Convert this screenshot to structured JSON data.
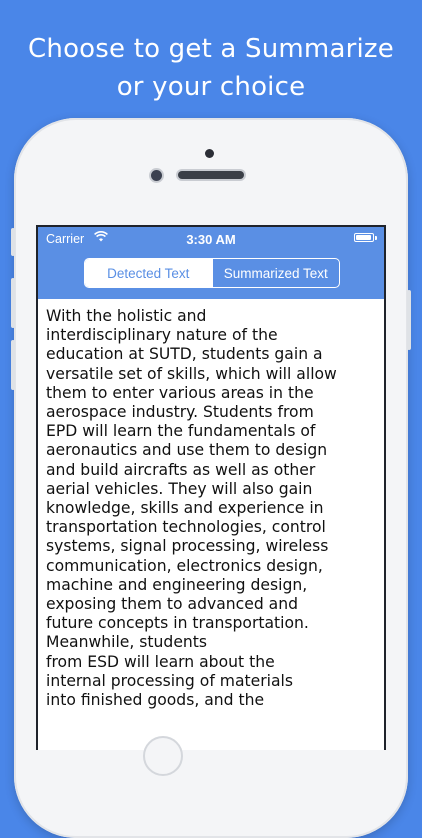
{
  "headline": {
    "line1": "Choose to get a Summarize",
    "line2": "or your choice"
  },
  "status_bar": {
    "carrier": "Carrier",
    "time": "3:30 AM",
    "battery_level": 1.0
  },
  "segmented_control": {
    "tabs": [
      {
        "label": "Detected Text",
        "selected": true
      },
      {
        "label": "Summarized Text",
        "selected": false
      }
    ]
  },
  "content": {
    "text": "With the holistic and\ninterdisciplinary nature of the\neducation at SUTD, students gain a\nversatile set of skills, which will allow\nthem to enter various areas in the\naerospace industry. Students from\nEPD will learn the fundamentals of\naeronautics and use them to design\nand build aircrafts as well as other\naerial vehicles. They will also gain\nknowledge, skills and experience in\ntransportation technologies, control\nsystems, signal processing, wireless\ncommunication, electronics design,\nmachine and engineering design,\nexposing them to advanced and\nfuture concepts in transportation.\nMeanwhile, students\nfrom ESD will learn about the\ninternal processing of materials\ninto finished goods, and the"
  },
  "colors": {
    "background": "#4a86e8",
    "navbar": "#5a8fe4",
    "text": "#111111"
  }
}
